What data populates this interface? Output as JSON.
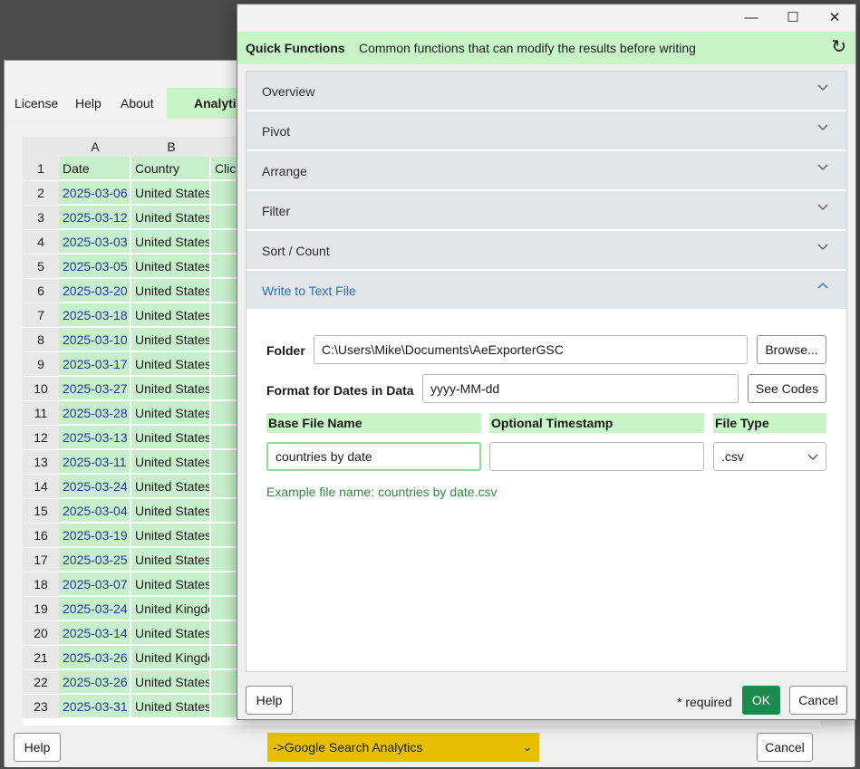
{
  "background_window": {
    "menu": [
      "License",
      "Help",
      "About"
    ],
    "active_tab": "Analytics",
    "grid": {
      "columns": [
        "A",
        "B"
      ],
      "headers": [
        "Date",
        "Country",
        "Clicks"
      ],
      "rows": [
        [
          "2025-03-06",
          "United States"
        ],
        [
          "2025-03-12",
          "United States"
        ],
        [
          "2025-03-03",
          "United States"
        ],
        [
          "2025-03-05",
          "United States"
        ],
        [
          "2025-03-20",
          "United States"
        ],
        [
          "2025-03-18",
          "United States"
        ],
        [
          "2025-03-10",
          "United States"
        ],
        [
          "2025-03-17",
          "United States"
        ],
        [
          "2025-03-27",
          "United States"
        ],
        [
          "2025-03-28",
          "United States"
        ],
        [
          "2025-03-13",
          "United States"
        ],
        [
          "2025-03-11",
          "United States"
        ],
        [
          "2025-03-24",
          "United States"
        ],
        [
          "2025-03-04",
          "United States"
        ],
        [
          "2025-03-19",
          "United States"
        ],
        [
          "2025-03-25",
          "United States"
        ],
        [
          "2025-03-07",
          "United States"
        ],
        [
          "2025-03-24",
          "United Kingdom"
        ],
        [
          "2025-03-14",
          "United States"
        ],
        [
          "2025-03-26",
          "United Kingdom"
        ],
        [
          "2025-03-26",
          "United States"
        ],
        [
          "2025-03-31",
          "United States"
        ]
      ]
    },
    "help_button": "Help",
    "source_select": "->Google Search Analytics",
    "cancel_button": "Cancel",
    "select_color": "#e6c000"
  },
  "dialog": {
    "controls": {
      "minimize": "—",
      "maximize": "☐",
      "close": "✕"
    },
    "quick_functions": {
      "title": "Quick Functions",
      "description": "Common functions that can modify the results before writing",
      "refresh_icon": "↻"
    },
    "sections": [
      {
        "label": "Overview",
        "expanded": false
      },
      {
        "label": "Pivot",
        "expanded": false
      },
      {
        "label": "Arrange",
        "expanded": false
      },
      {
        "label": "Filter",
        "expanded": false
      },
      {
        "label": "Sort / Count",
        "expanded": false
      },
      {
        "label": "Write to Text File",
        "expanded": true
      }
    ],
    "write_text_file": {
      "folder_label": "Folder",
      "folder_value": "C:\\Users\\Mike\\Documents\\AeExporterGSC",
      "browse_button": "Browse...",
      "date_format_label": "Format for Dates in Data",
      "date_format_value": "yyyy-MM-dd",
      "see_codes_button": "See Codes",
      "base_file_name_label": "Base File Name",
      "base_file_name_value": "countries by date",
      "optional_timestamp_label": "Optional Timestamp",
      "optional_timestamp_value": "",
      "file_type_label": "File Type",
      "file_type_value": ".csv",
      "example_text": "Example file name: countries by date.csv"
    },
    "footer": {
      "help_button": "Help",
      "required_note": "* required",
      "ok_button": "OK",
      "cancel_button": "Cancel"
    },
    "colors": {
      "accent_green": "#c8f5c8",
      "ok_green": "#1d8a4e",
      "link_blue": "#2a6ebb"
    }
  }
}
